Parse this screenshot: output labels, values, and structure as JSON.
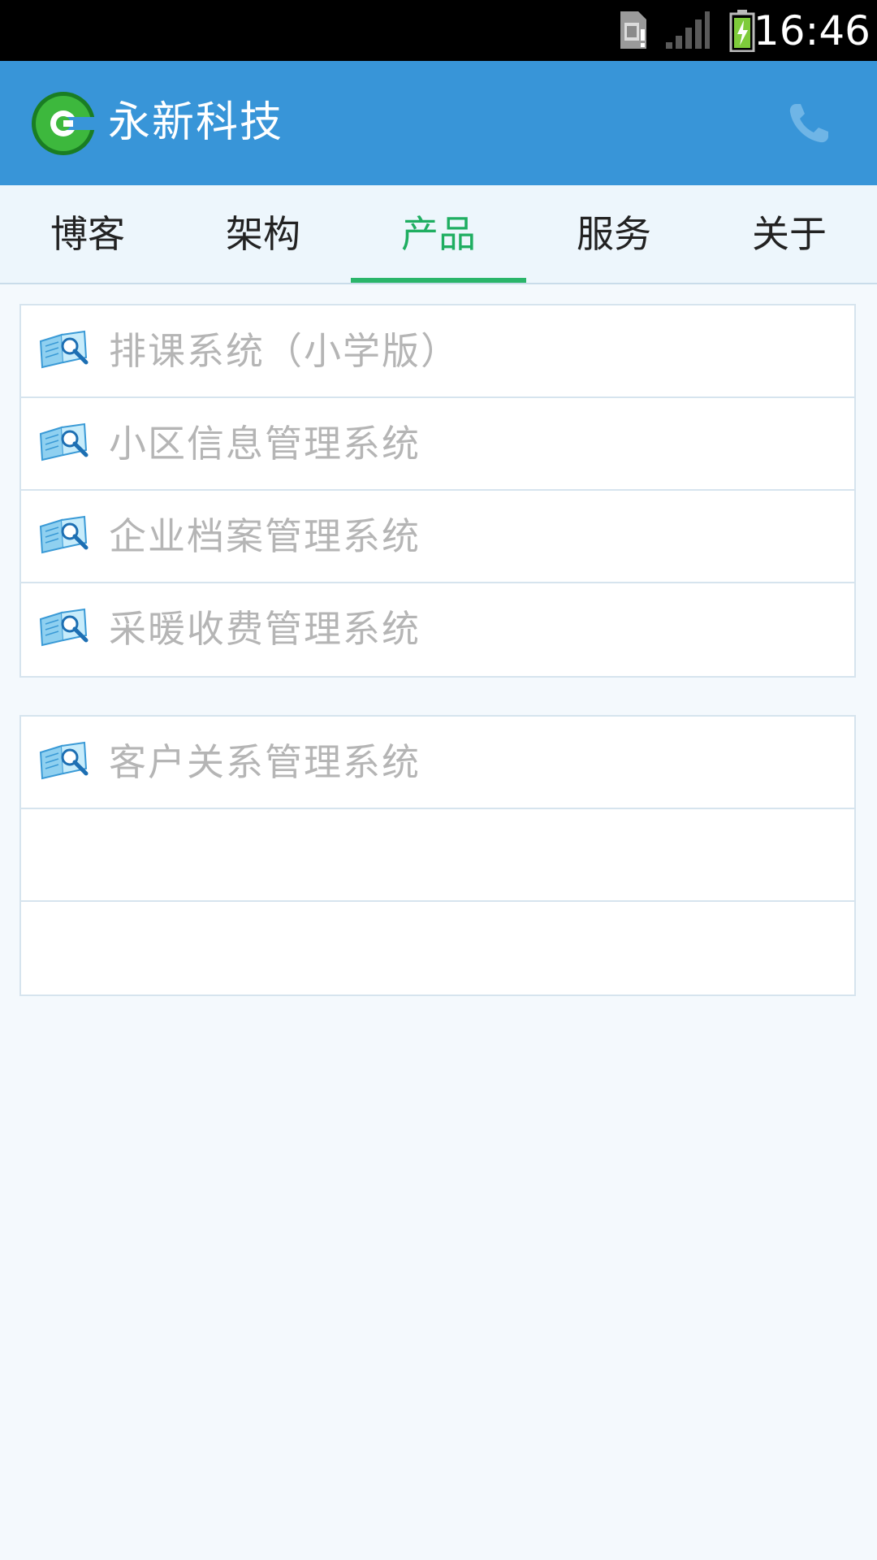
{
  "status_bar": {
    "time": "16:46",
    "icons": [
      "sim-card-alert-icon",
      "signal-icon",
      "battery-charging-icon"
    ]
  },
  "app_bar": {
    "title": "永新科技",
    "logo_icon": "c-logo-icon",
    "action_icon": "phone-icon",
    "color": "#3895d8"
  },
  "tabs": [
    {
      "label": "博客",
      "active": false
    },
    {
      "label": "架构",
      "active": false
    },
    {
      "label": "产品",
      "active": true
    },
    {
      "label": "服务",
      "active": false
    },
    {
      "label": "关于",
      "active": false
    }
  ],
  "accent_color": "#2ab56a",
  "product_groups": [
    {
      "items": [
        {
          "label": "排课系统（小学版）",
          "icon": "book-search-icon"
        },
        {
          "label": "小区信息管理系统",
          "icon": "book-search-icon"
        },
        {
          "label": "企业档案管理系统",
          "icon": "book-search-icon"
        },
        {
          "label": "采暖收费管理系统",
          "icon": "book-search-icon"
        }
      ]
    },
    {
      "items": [
        {
          "label": "客户关系管理系统",
          "icon": "book-search-icon"
        },
        {
          "label": "",
          "icon": ""
        },
        {
          "label": "",
          "icon": ""
        }
      ]
    }
  ]
}
